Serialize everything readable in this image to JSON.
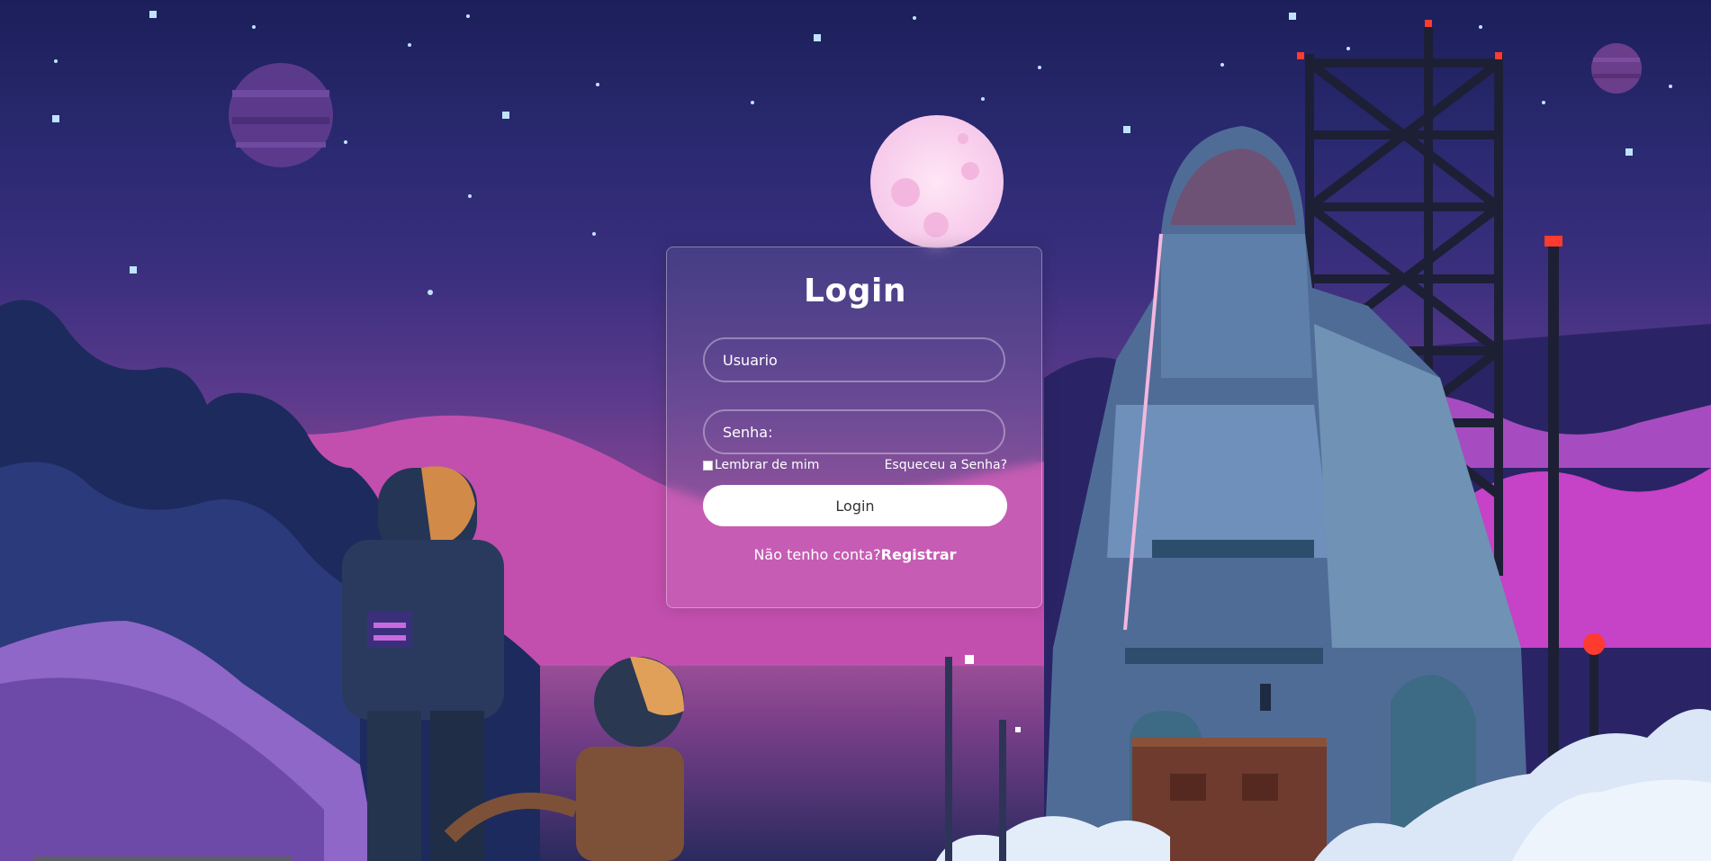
{
  "login_form": {
    "title": "Login",
    "username_placeholder": "Usuario",
    "password_placeholder": "Senha:",
    "remember_label": "Lembrar de mim",
    "forgot_label": "Esqueceu a Senha?",
    "submit_label": "Login",
    "no_account_text": "Não tenho conta?",
    "register_label": "Registrar"
  },
  "background": {
    "description_icons": [
      "moon-icon",
      "planet-icon",
      "star-icon",
      "rocket-icon",
      "launch-tower-icon",
      "astronaut-icon",
      "dog-astronaut-icon"
    ]
  }
}
